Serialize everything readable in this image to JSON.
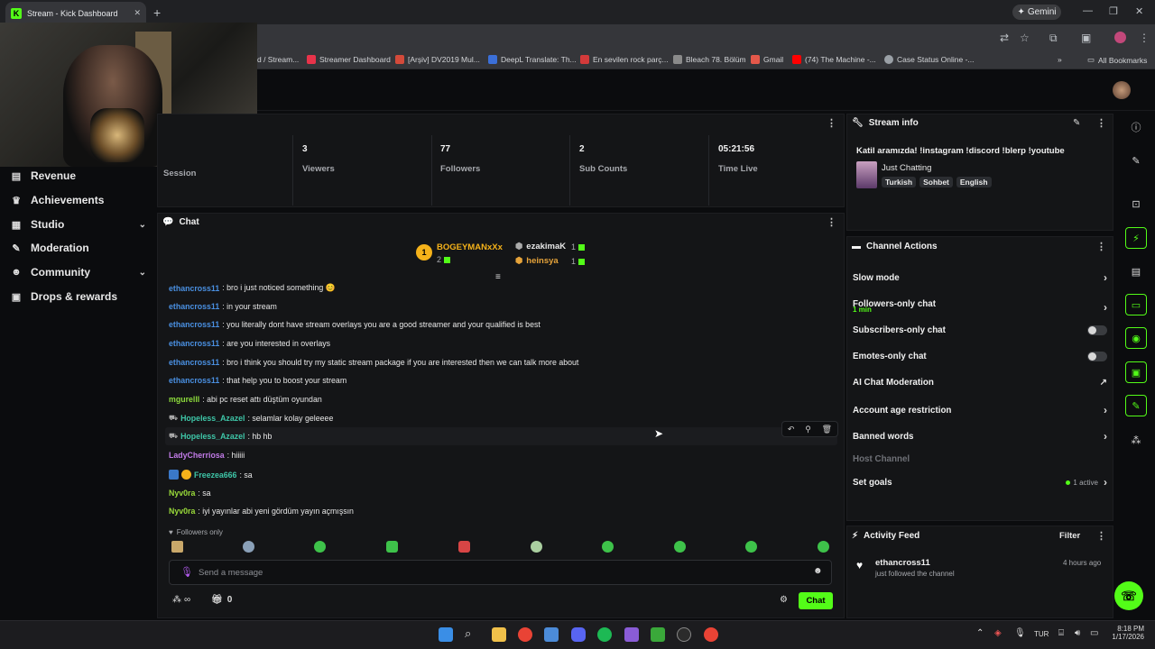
{
  "browser": {
    "tab_title": "Stream - Kick Dashboard",
    "new_tab": "+",
    "gemini_label": "Gemini",
    "bookmarks": [
      {
        "label": "d / Stream...",
        "color": "#53fc18"
      },
      {
        "label": "Streamer Dashboard",
        "color": "#e8334a"
      },
      {
        "label": "[Arşiv] DV2019 Mul...",
        "color": "#d34a3a"
      },
      {
        "label": "DeepL Translate: Th...",
        "color": "#3b6fd8"
      },
      {
        "label": "En sevilen rock parç...",
        "color": "#d33a3a"
      },
      {
        "label": "Bleach 78. Bölüm",
        "color": "#8a8a8a"
      },
      {
        "label": "Gmail",
        "color": "#e4584a"
      },
      {
        "label": "(74) The Machine -...",
        "color": "#ff0000"
      },
      {
        "label": "Case Status Online -...",
        "color": "#9aa0a6"
      }
    ],
    "all_bookmarks": "All Bookmarks"
  },
  "sidebar": {
    "items": [
      {
        "label": "Revenue",
        "icon": "revenue-icon"
      },
      {
        "label": "Achievements",
        "icon": "trophy-icon"
      },
      {
        "label": "Studio",
        "icon": "studio-icon",
        "expandable": true
      },
      {
        "label": "Moderation",
        "icon": "wrench-icon"
      },
      {
        "label": "Community",
        "icon": "users-icon",
        "expandable": true
      },
      {
        "label": "Drops & rewards",
        "icon": "gift-icon"
      }
    ]
  },
  "stats": {
    "session_label": "Session",
    "items": [
      {
        "value": "3",
        "label": "Viewers"
      },
      {
        "value": "77",
        "label": "Followers"
      },
      {
        "value": "2",
        "label": "Sub Counts"
      },
      {
        "value": "05:21:56",
        "label": "Time Live"
      }
    ]
  },
  "chat": {
    "title": "Chat",
    "leaderboard": {
      "first_user": "BOGEYMANxXx",
      "first_rank": "1",
      "first_count": "2",
      "second_user": "ezakimaK",
      "second_count": "1",
      "third_user": "heinsya",
      "third_count": "1"
    },
    "messages": [
      {
        "user": "ethancross11",
        "color": "#4a90e2",
        "text": ": bro i just noticed something 😊"
      },
      {
        "user": "ethancross11",
        "color": "#4a90e2",
        "text": ": in your stream"
      },
      {
        "user": "ethancross11",
        "color": "#4a90e2",
        "text": ": you literally dont have stream overlays you are a good streamer and your qualified is best"
      },
      {
        "user": "ethancross11",
        "color": "#4a90e2",
        "text": ": are you interested in overlays"
      },
      {
        "user": "ethancross11",
        "color": "#4a90e2",
        "text": ": bro i think you should try my static stream package if you are interested then we can talk more about"
      },
      {
        "user": "ethancross11",
        "color": "#4a90e2",
        "text": ": that help you to boost your stream"
      },
      {
        "user": "mgurelll",
        "color": "#8ddc3c",
        "text": ": abi pc reset attı düştüm oyundan"
      },
      {
        "user": "Hopeless_Azazel",
        "color": "#3ec6a8",
        "text": ": selamlar kolay geleeee"
      },
      {
        "user": "Hopeless_Azazel",
        "color": "#3ec6a8",
        "text": ": hb hb"
      },
      {
        "user": "LadyCherriosa",
        "color": "#c27be8",
        "text": ": hiiiii"
      },
      {
        "user": "Freezea666",
        "color": "#3ec6a8",
        "text": ": sa"
      },
      {
        "user": "Nyv0ra",
        "color": "#9adb3a",
        "text": ": sa"
      },
      {
        "user": "Nyv0ra",
        "color": "#9adb3a",
        "text": ": iyi yayınlar abi yeni gördüm yayın açmışsın"
      }
    ],
    "followers_only": "Followers only",
    "input_placeholder": "Send a message",
    "points_infinity": "∞",
    "gift_count": "0",
    "send_label": "Chat"
  },
  "stream_info": {
    "title": "Stream info",
    "stream_title": "Katil aramızda! !instagram !discord !blerp !youtube",
    "category": "Just Chatting",
    "tags": [
      "Turkish",
      "Sohbet",
      "English"
    ]
  },
  "channel_actions": {
    "title": "Channel Actions",
    "slow_mode": "Slow mode",
    "followers_only_chat": "Followers-only chat",
    "followers_only_sub": "1 min",
    "subscribers_only": "Subscribers-only chat",
    "emotes_only": "Emotes-only chat",
    "ai_moderation": "AI Chat Moderation",
    "age_restriction": "Account age restriction",
    "banned_words": "Banned words",
    "host_channel": "Host Channel",
    "set_goals": "Set goals",
    "goals_active": "1 active"
  },
  "activity": {
    "title": "Activity Feed",
    "filter": "Filter",
    "user": "ethancross11",
    "event": "just followed the channel",
    "time": "4 hours ago"
  },
  "taskbar": {
    "lang": "TUR",
    "time": "8:18 PM",
    "date": "1/17/2026"
  },
  "colors": {
    "accent": "#53fc18",
    "panel": "#141517",
    "background": "#0b0c0e"
  }
}
